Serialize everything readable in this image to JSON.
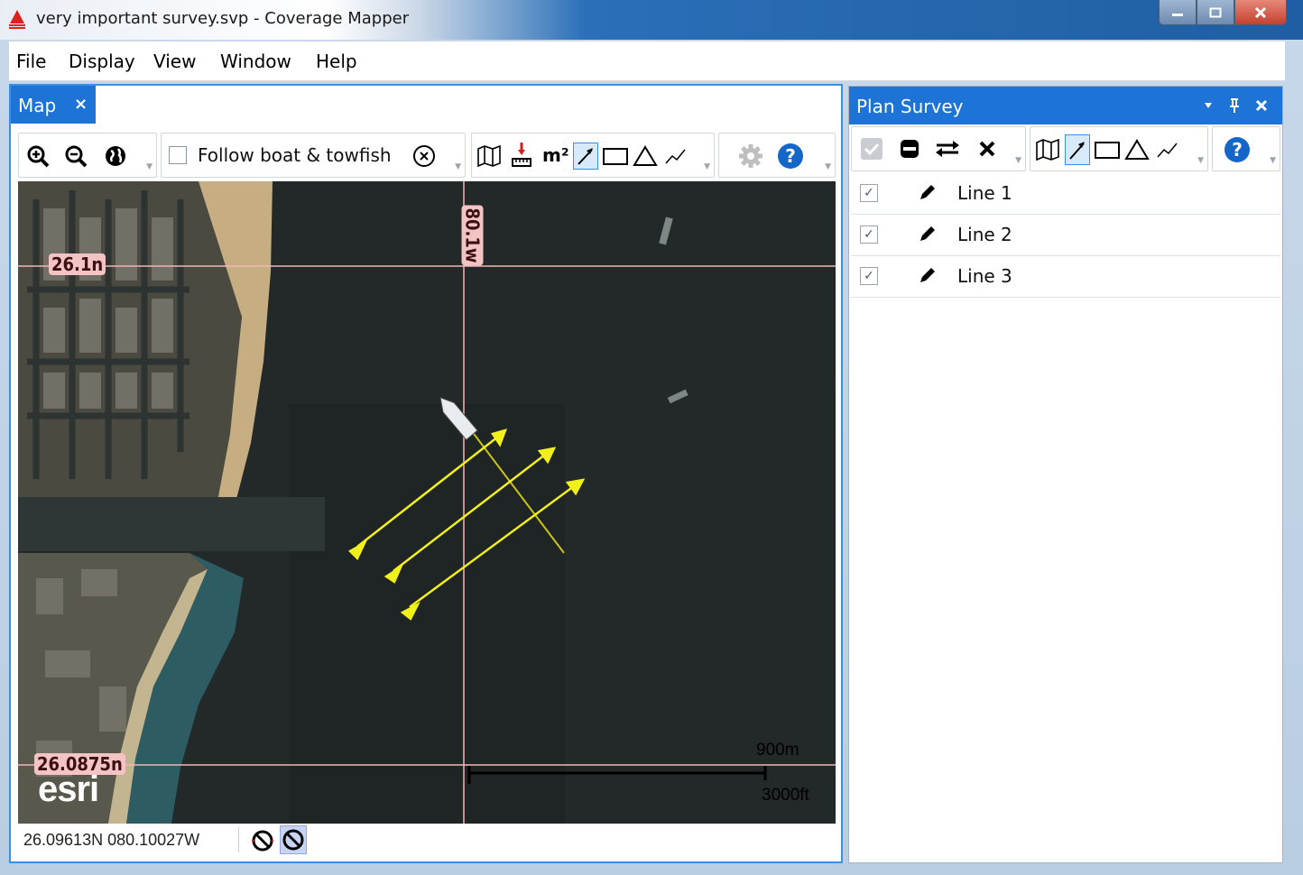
{
  "window": {
    "title": "very important survey.svp - Coverage Mapper"
  },
  "menubar": {
    "items": [
      "File",
      "Display",
      "View",
      "Window",
      "Help"
    ]
  },
  "map_tab": {
    "label": "Map",
    "close": "×"
  },
  "map_toolbar": {
    "follow_label": "Follow boat & towfish",
    "follow_checked": false,
    "area_label": "m²"
  },
  "map": {
    "graticule": {
      "lat_top": "26.1n",
      "lat_bottom": "26.0875n",
      "lon": "80.1w"
    },
    "scale": {
      "metric": "900m",
      "imperial": "3000ft"
    },
    "attribution": "esri",
    "survey_line_color": "#f2f01a",
    "graticule_color": "#f0b6b6"
  },
  "status": {
    "coords": "26.09613N 080.10027W"
  },
  "plan_panel": {
    "title": "Plan Survey",
    "lines": [
      {
        "label": "Line 1",
        "checked": true
      },
      {
        "label": "Line 2",
        "checked": true
      },
      {
        "label": "Line 3",
        "checked": true
      }
    ]
  },
  "colors": {
    "accent": "#1d74d6",
    "pane_border": "#3a8ee6"
  }
}
